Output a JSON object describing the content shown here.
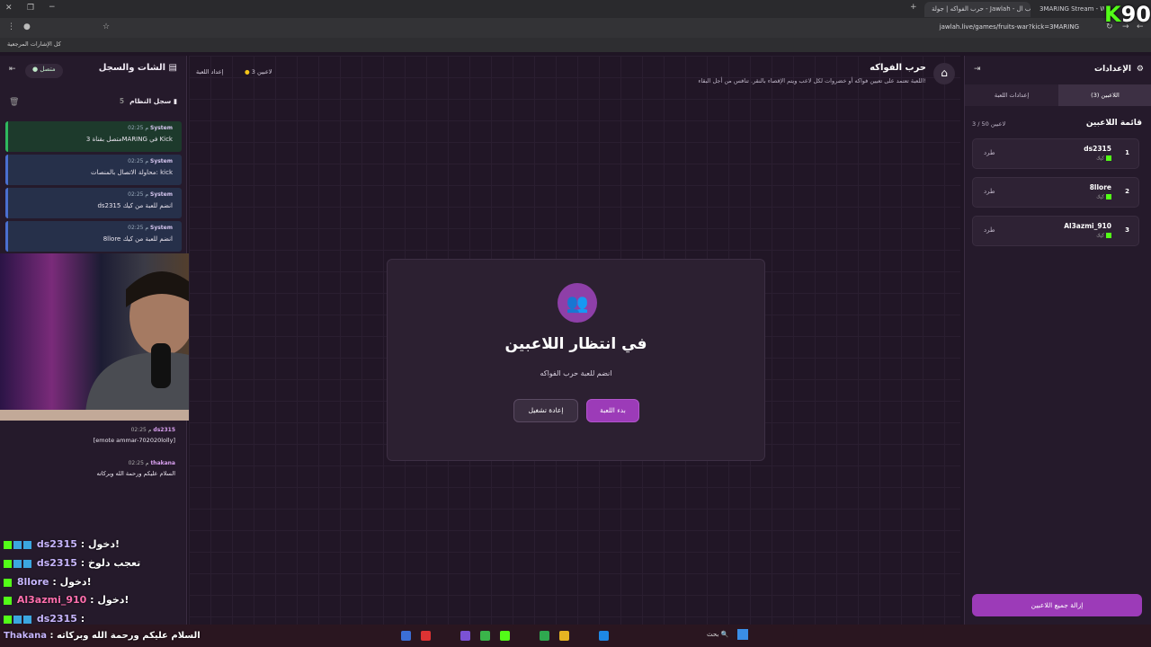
{
  "browser": {
    "tabs": [
      "حرب الفواكه | جولة - Jawlah - منصة الألعاب ال...",
      "3MARING Stream - Watch..."
    ],
    "url": "jawlah.live/games/fruits-war?kick=3MARING",
    "bookmark": "كل الإشارات المرجعية"
  },
  "badge": {
    "k": "K",
    "num": "90"
  },
  "chat": {
    "title": "الشات والسجل",
    "status": "متصل",
    "system_log_title": "سجل النظام",
    "system_log_count": "5",
    "messages": [
      {
        "user": "System",
        "time": "02:25 م",
        "text": "متصل بقناة 3MARING في Kick"
      },
      {
        "user": "System",
        "time": "02:25 م",
        "text": "محاولة الاتصال بالمنصات: kick"
      },
      {
        "user": "System",
        "time": "02:25 م",
        "text": "ds2315 انضم للعبة من كيك"
      },
      {
        "user": "System",
        "time": "02:25 م",
        "text": "8llore انضم للعبة من كيك"
      }
    ],
    "comments": [
      {
        "user": "ds2315",
        "time": "02:25 م",
        "text": "[emote ammar-702020lolly]"
      },
      {
        "user": "thakana",
        "time": "02:25 م",
        "text": "السلام عليكم ورحمة الله وبركاته"
      }
    ]
  },
  "overlay_chat": [
    {
      "name": "ds2315",
      "text": ": دخول!"
    },
    {
      "name": "ds2315",
      "text": ": تعجب دلوخ"
    },
    {
      "name": "8llore",
      "text": ": دخول!"
    },
    {
      "name": "Al3azmi_910",
      "text": ": دخول!"
    },
    {
      "name": "ds2315",
      "text": ":"
    },
    {
      "name": "Thakana",
      "text": ": السلام عليكم ورحمة الله وبركاته"
    }
  ],
  "game": {
    "title": "حرب الفواكه",
    "description": "اللعبة تعتمد على تعيين فواكه أو خضروات لكل لاعب ويتم الإقصاء بالنقر. تنافس من أجل البقاء!",
    "players_count": "3 لاعبين",
    "setup_label": "إعداد اللعبة"
  },
  "modal": {
    "title": "في انتظار اللاعبين",
    "subtitle": "انضم للعبة حرب الفواكه",
    "start_label": "بدء اللعبة",
    "restart_label": "إعادة تشغيل"
  },
  "settings": {
    "title": "الإعدادات",
    "tab_players": "اللاعبين (3)",
    "tab_game": "إعدادات اللعبة",
    "list_title": "قائمة اللاعبين",
    "list_count": "3 / 50 لاعبين",
    "players": [
      {
        "num": "1",
        "name": "ds2315",
        "platform": "كيك",
        "kick": "طرد"
      },
      {
        "num": "2",
        "name": "8llore",
        "platform": "كيك",
        "kick": "طرد"
      },
      {
        "num": "3",
        "name": "Al3azmi_910",
        "platform": "كيك",
        "kick": "طرد"
      }
    ],
    "remove_all": "إزالة جميع اللاعبين"
  },
  "taskbar": {
    "search": "بحث"
  }
}
